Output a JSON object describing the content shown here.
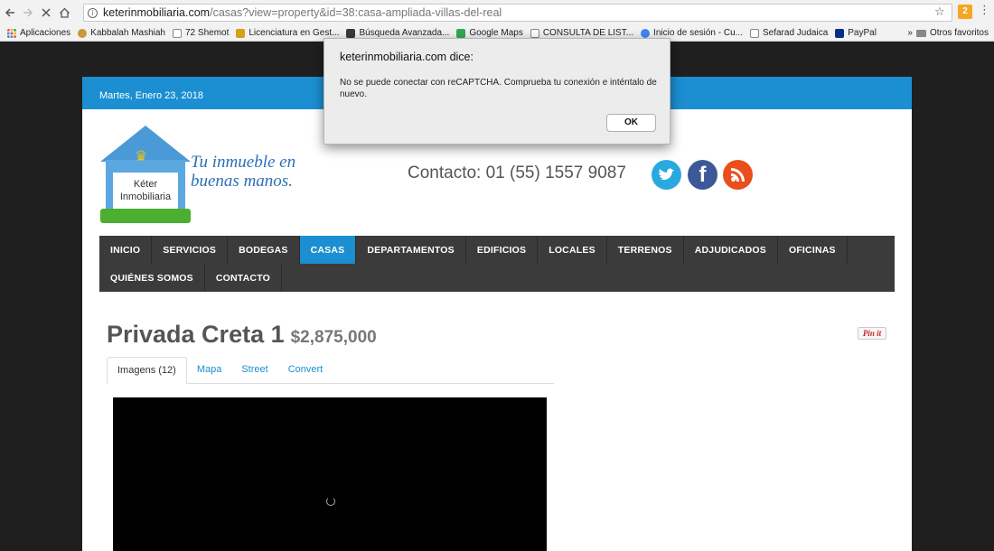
{
  "browser": {
    "url_host": "keterinmobiliaria.com",
    "url_path": "/casas?view=property&id=38:casa-ampliada-villas-del-real",
    "info_glyph": "i",
    "star_glyph": "☆",
    "menu_glyph": "⋮",
    "ext_label": "2",
    "bookmarks": [
      {
        "label": "Aplicaciones",
        "color": "#e0443a"
      },
      {
        "label": "Kabbalah Mashiah",
        "color": "#c79a3a"
      },
      {
        "label": "72 Shemot",
        "color": "#9e9e9e"
      },
      {
        "label": "Licenciatura en Gest...",
        "color": "#d4a017"
      },
      {
        "label": "Búsqueda Avanzada...",
        "color": "#3a3a3a"
      },
      {
        "label": "Google Maps",
        "color": "#34a853"
      },
      {
        "label": "CONSULTA DE LIST...",
        "color": "#9e9e9e"
      },
      {
        "label": "Inicio de sesión - Cu...",
        "color": "#4285f4"
      },
      {
        "label": "Sefarad Judaica",
        "color": "#9e9e9e"
      },
      {
        "label": "PayPal",
        "color": "#003087"
      }
    ],
    "more_glyph": "»",
    "other_bookmarks": "Otros favoritos"
  },
  "site": {
    "date": "Martes, Enero 23, 2018",
    "logo_line1": "Kéter",
    "logo_line2": "Inmobiliaria",
    "tagline_line1": "Tu inmueble en",
    "tagline_line2": "buenas manos.",
    "contact": "Contacto: 01 (55) 1557 9087",
    "facebook_glyph": "f",
    "nav": [
      "INICIO",
      "SERVICIOS",
      "BODEGAS",
      "CASAS",
      "DEPARTAMENTOS",
      "EDIFICIOS",
      "LOCALES",
      "TERRENOS",
      "ADJUDICADOS",
      "OFICINAS",
      "QUIÉNES SOMOS",
      "CONTACTO"
    ],
    "nav_active": "CASAS",
    "property_title": "Privada Creta 1",
    "property_price": "$2,875,000",
    "pinit": "Pin it",
    "tabs": [
      "Imagens (12)",
      "Mapa",
      "Street",
      "Convert"
    ]
  },
  "dialog": {
    "title": "keterinmobiliaria.com dice:",
    "message": "No se puede conectar con reCAPTCHA. Comprueba tu conexión e inténtalo de nuevo.",
    "ok": "OK"
  },
  "colors": {
    "accent": "#1b8fd1",
    "nav_bg": "#3b3b3b",
    "page_bg": "#1f1f1f"
  }
}
